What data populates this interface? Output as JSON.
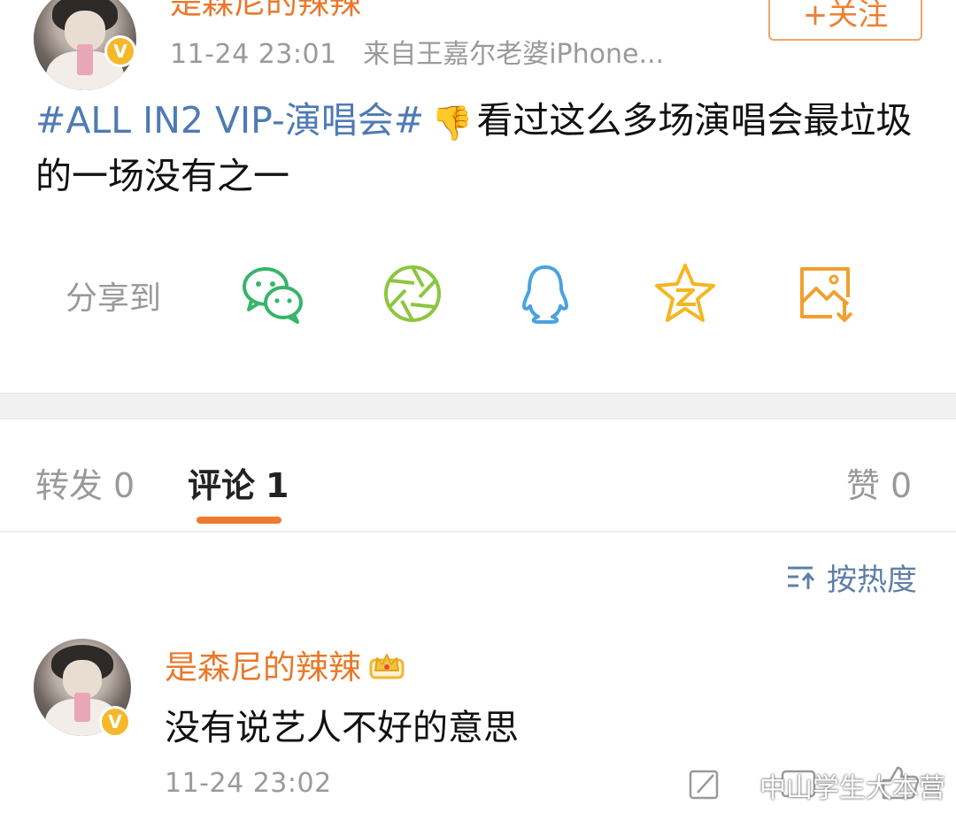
{
  "post": {
    "author": "是森尼的辣辣",
    "follow_label": "+关注",
    "time": "11-24 23:01",
    "source": "来自王嘉尔老婆iPhone...",
    "topic": "#ALL IN2 VIP-演唱会#",
    "emoji": "👎",
    "text": "看过这么多场演唱会最垃圾的一场没有之一"
  },
  "share": {
    "label": "分享到",
    "targets": [
      "wechat-icon",
      "moments-icon",
      "qq-icon",
      "qzone-icon",
      "save-image-icon"
    ]
  },
  "tabs": {
    "repost": {
      "label": "转发",
      "count": "0"
    },
    "comment": {
      "label": "评论",
      "count": "1"
    },
    "like": {
      "label": "赞",
      "count": "0"
    }
  },
  "sort": {
    "label": "按热度"
  },
  "comment": {
    "author": "是森尼的辣辣",
    "text": "没有说艺人不好的意思",
    "time": "11-24 23:02"
  },
  "watermark": {
    "text": "中山学生大本营"
  },
  "colors": {
    "accent": "#ee7a2f",
    "topic": "#4f7ab3",
    "author": "#e8792b",
    "muted": "#9a9a9a",
    "wechat": "#37b568",
    "moments": "#8cc63f",
    "qq": "#4aa3df",
    "qzone": "#f4b621",
    "save": "#f0a030"
  }
}
